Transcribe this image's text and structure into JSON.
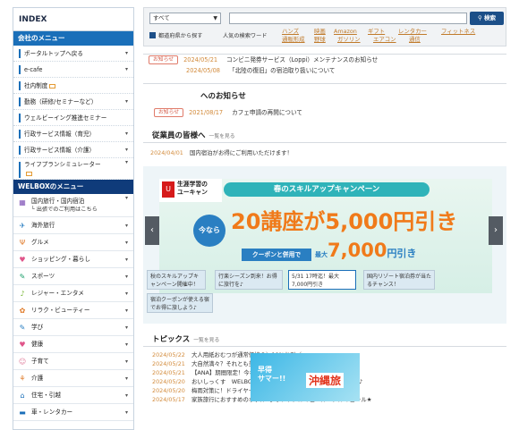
{
  "sidebar": {
    "index_title": "INDEX",
    "company_menu_title": "会社のメニュー",
    "company_items": [
      {
        "label": "ポータルトップへ戻る"
      },
      {
        "label": "e-cafe"
      },
      {
        "label": "社内制度"
      },
      {
        "label": "勤務（研修/セミナーなど）"
      },
      {
        "label": "ウェルビーイング推進セミナー"
      },
      {
        "label": "行政サービス情報（育児）"
      },
      {
        "label": "行政サービス情報（介護）"
      },
      {
        "label": "ライフプランシミュレーター"
      }
    ],
    "welbox_menu_title": "WELBOXのメニュー",
    "welbox_items": [
      {
        "label": "国内旅行・国内宿泊",
        "sub": "└ 出張でのご利用はこちら",
        "icon": "✈"
      },
      {
        "label": "海外旅行",
        "icon": "✈"
      },
      {
        "label": "グルメ",
        "icon": "♨"
      },
      {
        "label": "ショッピング・暮らし",
        "icon": "♥"
      },
      {
        "label": "スポーツ",
        "icon": "✎"
      },
      {
        "label": "レジャー・エンタメ",
        "icon": "♪"
      },
      {
        "label": "リラク・ビューティー",
        "icon": "✿"
      },
      {
        "label": "学び",
        "icon": "✎"
      },
      {
        "label": "健康",
        "icon": "♥"
      },
      {
        "label": "子育て",
        "icon": "✉"
      },
      {
        "label": "介護",
        "icon": "⌂"
      },
      {
        "label": "住宅・引越",
        "icon": "⌂"
      },
      {
        "label": "車・レンタカー",
        "icon": "⚲"
      }
    ]
  },
  "search": {
    "select_value": "すべて",
    "button_label": "検索",
    "map_link": "都道府県から探す",
    "popular_label": "人気の検索ワード",
    "keywords": [
      "ハンズ",
      "映画",
      "Amazon",
      "ギフト",
      "レンタカー",
      "フィットネス",
      "通販形成",
      "野球",
      "ガソリン",
      "エアコン",
      "通信"
    ]
  },
  "news": [
    {
      "tag": "お知らせ",
      "date": "2024/05/21",
      "text": "コンビニ発券サービス（Loppi）メンテナンスのお知らせ"
    },
    {
      "tag": "",
      "date": "2024/05/08",
      "text": "「北陸の復旧」の宿泊取り扱いについて"
    }
  ],
  "notice": {
    "title": "へのお知らせ",
    "items": [
      {
        "tag": "お知らせ",
        "date": "2021/08/17",
        "text": "カフェ申請の再開について"
      }
    ]
  },
  "employee": {
    "title": "従業員の皆様へ",
    "more": "一覧を見る",
    "items": [
      {
        "date": "2024/04/01",
        "text": "国内宿泊がお得にご利用いただけます！"
      }
    ]
  },
  "banner": {
    "logo_text": "生涯学習の\nユーキャン",
    "headline": "春のスキルアップキャンペーン",
    "now": "今なら",
    "main": "20講座が5,000円引き",
    "coupon": "クーポンと併用で",
    "sub_max": "最大",
    "sub_amount": "7,000",
    "sub_suffix": "円引き",
    "prev": "‹",
    "next": "›",
    "thumbs": [
      {
        "text": "秋のスキルアップキャンペーン開催中！"
      },
      {
        "text": "行楽シーズン到来！お得に旅行を♪"
      },
      {
        "text": "5/31 17時迄！最大7,000円引き"
      },
      {
        "text": "国内リゾート宿泊券が当たるチャンス！"
      },
      {
        "text": "宿泊クーポンが使える宿でお得に旅しよう♪"
      }
    ]
  },
  "topics": {
    "title": "トピックス",
    "more": "一覧を見る",
    "items": [
      {
        "date": "2024/05/22",
        "text": "大人用紙おむつが通常価格の＼10%お引／"
      },
      {
        "date": "2024/05/21",
        "text": "大自然満々？それとも美味しい食事？♪北海道特集はこちら＞＞"
      },
      {
        "date": "2024/05/21",
        "text": "【ANA】期間限定！今ならもれなく【5,000コイン】還元！"
      },
      {
        "date": "2024/05/20",
        "text": "おいしっくす　WELBOX会員限定の「おためしセット」をご用意♪"
      },
      {
        "date": "2024/05/20",
        "text": "梅雨対策に！ドライヤー特集＼数量限定！クーポン配布中／"
      },
      {
        "date": "2024/05/17",
        "text": "家族旅行におすすめのホテル♪グランドメルキュール・メルキュール★"
      }
    ],
    "side_banner": {
      "line1": "早得\nサマー!!",
      "line2": "沖縄旅"
    }
  }
}
